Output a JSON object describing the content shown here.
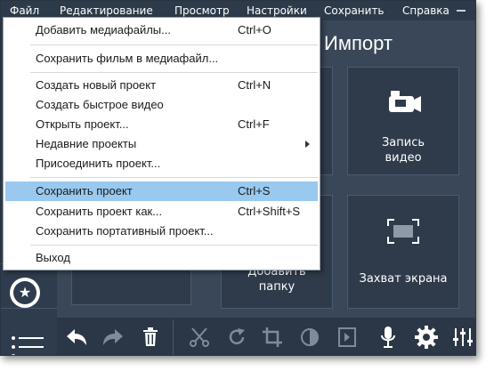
{
  "menubar": {
    "items": [
      "Файл",
      "Редактирование",
      "Просмотр",
      "Настройки",
      "Сохранить",
      "Справка"
    ]
  },
  "main": {
    "title": "Импорт",
    "tiles": [
      {
        "label_line1": "Запись",
        "label_line2": "видео",
        "icon": "video-camera-icon"
      },
      {
        "label_line1": "Добавить",
        "label_line2": "папку",
        "icon": "folder-icon"
      },
      {
        "label_line1": "Захват экрана",
        "label_line2": "",
        "icon": "screen-capture-icon"
      }
    ]
  },
  "file_menu": {
    "items": [
      {
        "label": "Добавить медиафайлы...",
        "shortcut": "Ctrl+O"
      },
      {
        "label": "Сохранить фильм в медиафайл...",
        "shortcut": ""
      },
      {
        "label": "Создать новый проект",
        "shortcut": "Ctrl+N"
      },
      {
        "label": "Создать быстрое видео",
        "shortcut": ""
      },
      {
        "label": "Открыть проект...",
        "shortcut": "Ctrl+F"
      },
      {
        "label": "Недавние проекты",
        "shortcut": "",
        "submenu": true
      },
      {
        "label": "Присоединить проект...",
        "shortcut": ""
      },
      {
        "label": "Сохранить проект",
        "shortcut": "Ctrl+S",
        "highlighted": true
      },
      {
        "label": "Сохранить проект как...",
        "shortcut": "Ctrl+Shift+S"
      },
      {
        "label": "Сохранить портативный проект...",
        "shortcut": ""
      },
      {
        "label": "Выход",
        "shortcut": ""
      }
    ]
  },
  "toolbar": {
    "icons": [
      "undo-icon",
      "redo-icon",
      "delete-icon",
      "cut-icon",
      "rotate-icon",
      "crop-icon",
      "color-adjust-icon",
      "clip-properties-icon",
      "microphone-icon",
      "settings-icon",
      "equalizer-icon"
    ]
  },
  "sidebar": {
    "icons": [
      "star-icon",
      "list-icon"
    ]
  },
  "colors": {
    "window_bg": "#3c4a5c",
    "menu_highlight": "#99c9ef",
    "toolbar_bg": "#2b3746"
  }
}
